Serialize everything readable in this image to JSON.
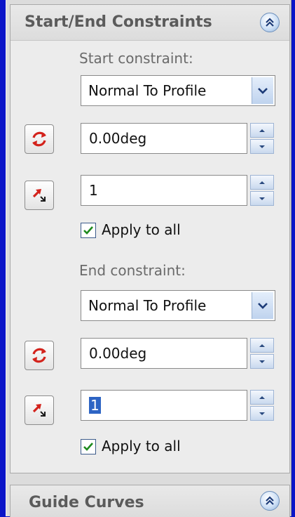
{
  "start_end_panel": {
    "title": "Start/End Constraints",
    "start": {
      "label": "Start constraint:",
      "dropdown_value": "Normal To Profile",
      "angle_value": "0.00deg",
      "tangent_value": "1",
      "apply_all_label": "Apply to all",
      "apply_all_checked": true
    },
    "end": {
      "label": "End constraint:",
      "dropdown_value": "Normal To Profile",
      "angle_value": "0.00deg",
      "tangent_value": "1",
      "apply_all_label": "Apply to all",
      "apply_all_checked": true
    }
  },
  "guide_panel": {
    "title": "Guide Curves"
  },
  "icons": {
    "collapse": "double-chevron-up-icon",
    "rotate": "rotate-arrows-icon",
    "tangent": "tangent-length-icon",
    "dropdown": "chevron-down-icon",
    "check": "checkmark-icon"
  },
  "colors": {
    "background": "#0a14c8",
    "selection": "#2d64c4",
    "icon_red": "#d3231c"
  }
}
